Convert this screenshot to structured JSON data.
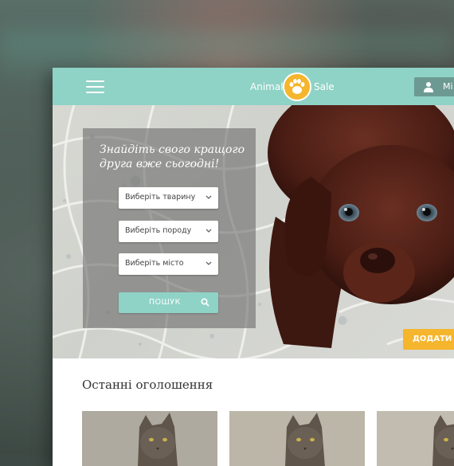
{
  "header": {
    "logo_left": "Animal",
    "logo_right": "Sale",
    "login_label": "Мі"
  },
  "hero": {
    "title_line1": "Знайдіть свого кращого",
    "title_line2": "друга вже сьогодні!",
    "selects": [
      {
        "placeholder": "Виберіть тварину"
      },
      {
        "placeholder": "Виберіть породу"
      },
      {
        "placeholder": "Виберіть місто"
      }
    ],
    "search_label": "ПОШУК",
    "add_label": "ДОДАТИ О"
  },
  "listings": {
    "title": "Останні оголошення",
    "cards": [
      {
        "image": "cat-photo"
      },
      {
        "image": "cat-photo"
      },
      {
        "image": "cat-photo"
      }
    ]
  },
  "colors": {
    "accent": "#8fd2c6",
    "brand_yellow": "#f5b52c",
    "login_bg": "#6c9a92"
  }
}
